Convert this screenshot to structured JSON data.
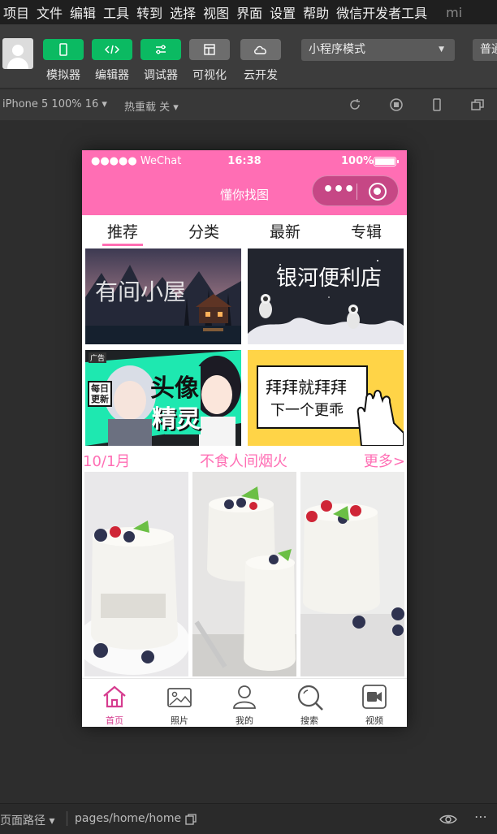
{
  "menu": {
    "items": [
      "项目",
      "文件",
      "编辑",
      "工具",
      "转到",
      "选择",
      "视图",
      "界面",
      "设置",
      "帮助",
      "微信开发者工具"
    ],
    "title": "mi"
  },
  "toolbar": {
    "buttons": [
      {
        "label": "模拟器",
        "icon": "phone-icon",
        "color": "#0bba62"
      },
      {
        "label": "编辑器",
        "icon": "code-icon",
        "color": "#0bba62"
      },
      {
        "label": "调试器",
        "icon": "debug-icon",
        "color": "#0bba62"
      },
      {
        "label": "可视化",
        "icon": "layout-icon",
        "color": "#6d6d6d"
      },
      {
        "label": "云开发",
        "icon": "cloud-icon",
        "color": "#6d6d6d"
      }
    ],
    "mode_select": "小程序模式",
    "mode_select_2": "普通"
  },
  "simbar": {
    "device": "iPhone 5 100% 16 ▾",
    "hot_reload": "热重载 关 ▾"
  },
  "phone": {
    "status": {
      "carrier": "●●●●● WeChat",
      "time": "16:38",
      "battery": "100%"
    },
    "nav_title": "懂你找图",
    "tabs": [
      "推荐",
      "分类",
      "最新",
      "专辑"
    ],
    "active_tab": 0,
    "banners": [
      {
        "text": "有间小屋"
      },
      {
        "text": "银河便利店"
      },
      {
        "tag": "广告",
        "badge": "每日更新",
        "text1": "头像",
        "text2": "精灵"
      },
      {
        "text1": "拜拜就拜拜",
        "text2": "下一个更乖"
      }
    ],
    "section": {
      "date": "10/1月",
      "title": "不食人间烟火",
      "more": "更多>"
    },
    "tabbar": [
      {
        "label": "首页",
        "icon": "home-icon",
        "active": true
      },
      {
        "label": "照片",
        "icon": "photo-icon",
        "active": false
      },
      {
        "label": "我的",
        "icon": "user-icon",
        "active": false
      },
      {
        "label": "搜索",
        "icon": "search-icon",
        "active": false
      },
      {
        "label": "视频",
        "icon": "video-icon",
        "active": false
      }
    ]
  },
  "bottom": {
    "path_label": "页面路径 ▾",
    "path": "pages/home/home"
  },
  "colors": {
    "accent": "#ff6eb4",
    "tab_active": "#d63c8f",
    "green": "#0bba62"
  }
}
